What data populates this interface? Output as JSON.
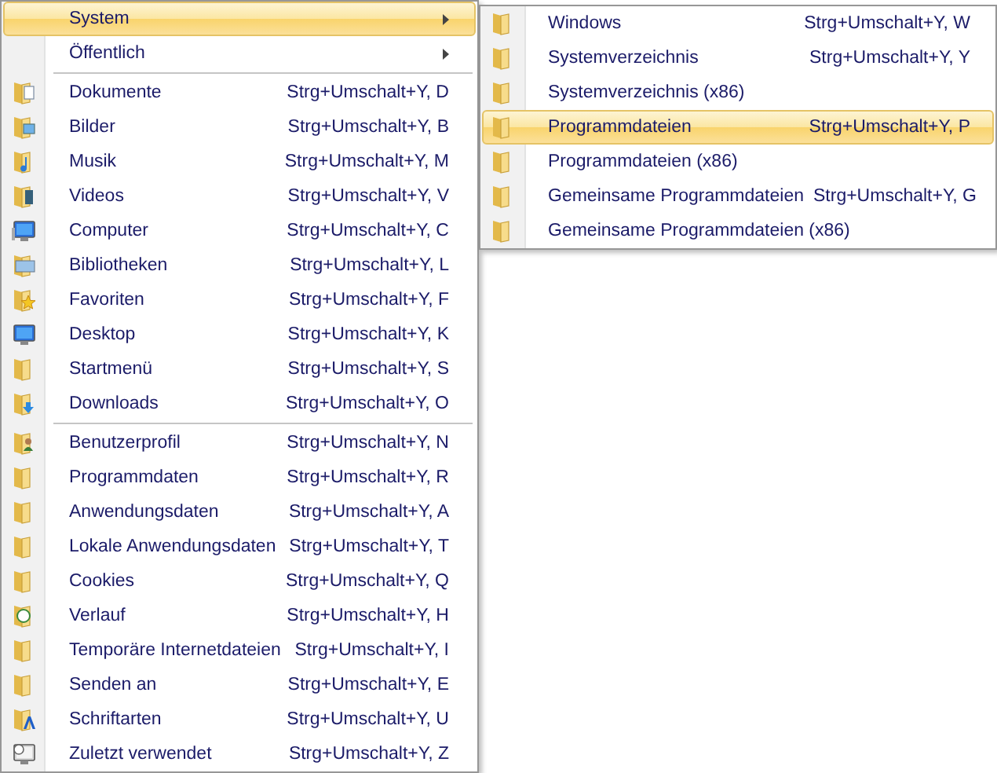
{
  "menu": {
    "items": [
      {
        "kind": "submenu",
        "label": "System",
        "selected": true
      },
      {
        "kind": "submenu",
        "label": "Öffentlich",
        "selected": false
      },
      {
        "kind": "separator"
      },
      {
        "kind": "item",
        "label": "Dokumente",
        "shortcut": "Strg+Umschalt+Y, D",
        "selected": false
      },
      {
        "kind": "item",
        "label": "Bilder",
        "shortcut": "Strg+Umschalt+Y, B",
        "selected": false
      },
      {
        "kind": "item",
        "label": "Musik",
        "shortcut": "Strg+Umschalt+Y, M",
        "selected": false
      },
      {
        "kind": "item",
        "label": "Videos",
        "shortcut": "Strg+Umschalt+Y, V",
        "selected": false
      },
      {
        "kind": "item",
        "label": "Computer",
        "shortcut": "Strg+Umschalt+Y, C",
        "selected": false
      },
      {
        "kind": "item",
        "label": "Bibliotheken",
        "shortcut": "Strg+Umschalt+Y, L",
        "selected": false
      },
      {
        "kind": "item",
        "label": "Favoriten",
        "shortcut": "Strg+Umschalt+Y, F",
        "selected": false
      },
      {
        "kind": "item",
        "label": "Desktop",
        "shortcut": "Strg+Umschalt+Y, K",
        "selected": false
      },
      {
        "kind": "item",
        "label": "Startmenü",
        "shortcut": "Strg+Umschalt+Y, S",
        "selected": false
      },
      {
        "kind": "item",
        "label": "Downloads",
        "shortcut": "Strg+Umschalt+Y, O",
        "selected": false
      },
      {
        "kind": "separator"
      },
      {
        "kind": "item",
        "label": "Benutzerprofil",
        "shortcut": "Strg+Umschalt+Y, N",
        "selected": false
      },
      {
        "kind": "item",
        "label": "Programmdaten",
        "shortcut": "Strg+Umschalt+Y, R",
        "selected": false
      },
      {
        "kind": "item",
        "label": "Anwendungsdaten",
        "shortcut": "Strg+Umschalt+Y, A",
        "selected": false
      },
      {
        "kind": "item",
        "label": "Lokale Anwendungsdaten",
        "shortcut": "Strg+Umschalt+Y, T",
        "selected": false
      },
      {
        "kind": "item",
        "label": "Cookies",
        "shortcut": "Strg+Umschalt+Y, Q",
        "selected": false
      },
      {
        "kind": "item",
        "label": "Verlauf",
        "shortcut": "Strg+Umschalt+Y, H",
        "selected": false
      },
      {
        "kind": "item",
        "label": "Temporäre Internetdateien",
        "shortcut": "Strg+Umschalt+Y, I",
        "selected": false
      },
      {
        "kind": "item",
        "label": "Senden an",
        "shortcut": "Strg+Umschalt+Y, E",
        "selected": false
      },
      {
        "kind": "item",
        "label": "Schriftarten",
        "shortcut": "Strg+Umschalt+Y, U",
        "selected": false
      },
      {
        "kind": "item",
        "label": "Zuletzt verwendet",
        "shortcut": "Strg+Umschalt+Y, Z",
        "selected": false
      }
    ]
  },
  "submenu": {
    "items": [
      {
        "kind": "item",
        "label": "Windows",
        "shortcut": "Strg+Umschalt+Y, W",
        "selected": false
      },
      {
        "kind": "item",
        "label": "Systemverzeichnis",
        "shortcut": "Strg+Umschalt+Y, Y",
        "selected": false
      },
      {
        "kind": "item",
        "label": "Systemverzeichnis (x86)",
        "selected": false
      },
      {
        "kind": "item",
        "label": "Programmdateien",
        "shortcut": "Strg+Umschalt+Y, P",
        "selected": true
      },
      {
        "kind": "item",
        "label": "Programmdateien (x86)",
        "selected": false
      },
      {
        "kind": "item",
        "label": "Gemeinsame Programmdateien",
        "shortcut": "Strg+Umschalt+Y, G",
        "selected": false
      },
      {
        "kind": "item",
        "label": "Gemeinsame Programmdateien (x86)",
        "selected": false
      }
    ]
  }
}
